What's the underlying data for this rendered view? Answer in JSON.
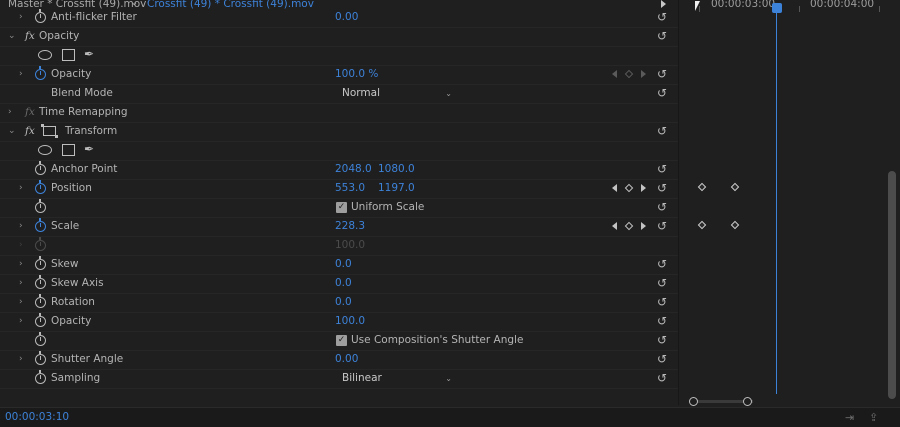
{
  "header": {
    "master_label": "Master * Crossfit (49).mov",
    "clip_label": "Crossfit (49) * Crossfit (49).mov"
  },
  "rows": {
    "anti_flicker": {
      "name": "Anti-flicker Filter",
      "value": "0.00"
    },
    "opacity_group": {
      "name": "Opacity"
    },
    "opacity": {
      "name": "Opacity",
      "value": "100.0 %"
    },
    "blend_mode": {
      "name": "Blend Mode",
      "value": "Normal"
    },
    "time_remapping": {
      "name": "Time Remapping"
    },
    "transform_group": {
      "name": "Transform"
    },
    "anchor_point": {
      "name": "Anchor Point",
      "x": "2048.0",
      "y": "1080.0"
    },
    "position": {
      "name": "Position",
      "x": "553.0",
      "y": "1197.0"
    },
    "uniform_scale": {
      "label": "Uniform Scale",
      "checked": true
    },
    "scale": {
      "name": "Scale",
      "value": "228.3"
    },
    "scale_width": {
      "value": "100.0"
    },
    "skew": {
      "name": "Skew",
      "value": "0.0"
    },
    "skew_axis": {
      "name": "Skew Axis",
      "value": "0.0"
    },
    "rotation": {
      "name": "Rotation",
      "value": "0.0"
    },
    "opacity2": {
      "name": "Opacity",
      "value": "100.0"
    },
    "comp_shutter": {
      "label": "Use Composition's Shutter Angle",
      "checked": true
    },
    "shutter_angle": {
      "name": "Shutter Angle",
      "value": "0.00"
    },
    "sampling": {
      "name": "Sampling",
      "value": "Bilinear"
    }
  },
  "timeline": {
    "tc_left": "00:00:03:00",
    "tc_right": "00:00:04:00"
  },
  "footer": {
    "current_time": "00:00:03:10"
  },
  "colors": {
    "accent": "#3d82d9",
    "panel_bg": "#1f1f1f",
    "text": "#b4b4b4"
  },
  "icons": [
    "stopwatch-icon",
    "reset-icon",
    "ellipse-mask-icon",
    "rectangle-mask-icon",
    "pen-mask-icon",
    "transform-icon",
    "keyframe-icon",
    "playhead-icon"
  ]
}
